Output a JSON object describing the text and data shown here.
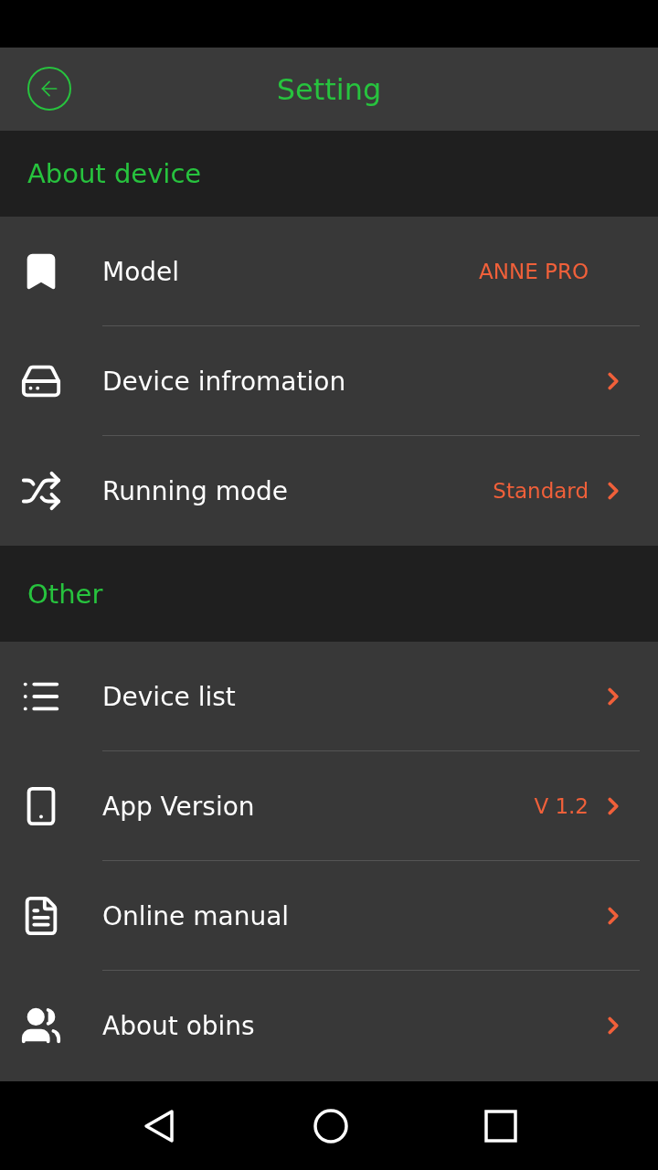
{
  "header": {
    "title": "Setting"
  },
  "sections": [
    {
      "title": "About device",
      "rows": [
        {
          "kind": "info",
          "label": "Model",
          "value": "ANNE PRO"
        },
        {
          "kind": "link",
          "label": "Device infromation"
        },
        {
          "kind": "link",
          "label": "Running mode",
          "value": "Standard"
        }
      ]
    },
    {
      "title": "Other",
      "rows": [
        {
          "kind": "link",
          "label": "Device list"
        },
        {
          "kind": "link",
          "label": "App Version",
          "value": "V 1.2"
        },
        {
          "kind": "link",
          "label": "Online manual"
        },
        {
          "kind": "link",
          "label": "About obins"
        }
      ]
    }
  ]
}
